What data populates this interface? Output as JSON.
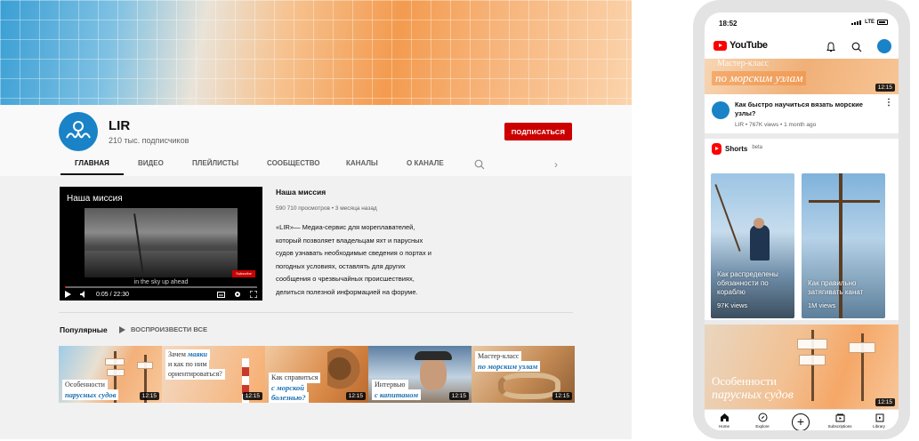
{
  "desktop": {
    "channel": {
      "name": "LIR",
      "subscribers": "210 тыс. подписчиков",
      "subscribe_label": "Подписаться"
    },
    "tabs": [
      {
        "label": "Главная",
        "active": true
      },
      {
        "label": "Видео",
        "active": false
      },
      {
        "label": "Плейлисты",
        "active": false
      },
      {
        "label": "Сообщество",
        "active": false
      },
      {
        "label": "Каналы",
        "active": false
      },
      {
        "label": "О канале",
        "active": false
      }
    ],
    "featured": {
      "overlay_title": "Наша миссия",
      "caption": "in the sky up ahead",
      "logo_text": "Subscribe",
      "time": "0:05 / 22:30",
      "progress": 0.004,
      "title": "Наша миссия",
      "meta": "590 710 просмотров • 3 месяца назад",
      "description": "«LIR»— Медиа-сервис для мореплавателей, который позволяет владельцам яхт и парусных судов узнавать необходимые сведения о портах и погодных условиях, оставлять для других сообщения о чрезвычайных происшествиях, делиться полезной информацией на форуме."
    },
    "popular": {
      "label": "Популярные",
      "play_all": "Воспроизвести все",
      "videos": [
        {
          "line1": "Особенности",
          "line2": "парусных судов",
          "duration": "12:15"
        },
        {
          "line1": "Зачем",
          "accent": "маяки",
          "line2": "и как по ним",
          "line3": "ориентироваться?",
          "duration": "12:15"
        },
        {
          "line1": "Как справиться",
          "line2": "с морской",
          "line3": "болезнью?",
          "duration": "12:15"
        },
        {
          "line1": "Интервью",
          "line2": "с капитаном",
          "duration": "12:15"
        },
        {
          "line1": "Мастер-класс",
          "line2": "по морским узлам",
          "duration": "12:15"
        }
      ]
    }
  },
  "mobile": {
    "status_time": "18:52",
    "status_network": "LTE",
    "app_name": "YouTube",
    "top_video": {
      "caption_small": "Мастер-класс",
      "caption": "по морским узлам",
      "duration": "12:15",
      "title": "Как быстро научиться вязать морские узлы?",
      "meta": "LIR • 767K views • 1 month ago"
    },
    "shorts": {
      "title": "Shorts",
      "badge": "beta",
      "items": [
        {
          "title": "Как распределены обязанности по кораблю",
          "views": "97K views"
        },
        {
          "title": "Как правильно затягивать канат",
          "views": "1M views"
        }
      ]
    },
    "big_video": {
      "line1": "Особенности",
      "line2": "парусных судов",
      "duration": "12:15"
    },
    "nav": [
      {
        "label": "Home",
        "icon": "home-icon"
      },
      {
        "label": "Explore",
        "icon": "compass-icon"
      },
      {
        "label": "Subscriptions",
        "icon": "subscriptions-icon"
      },
      {
        "label": "Library",
        "icon": "library-icon"
      }
    ]
  }
}
